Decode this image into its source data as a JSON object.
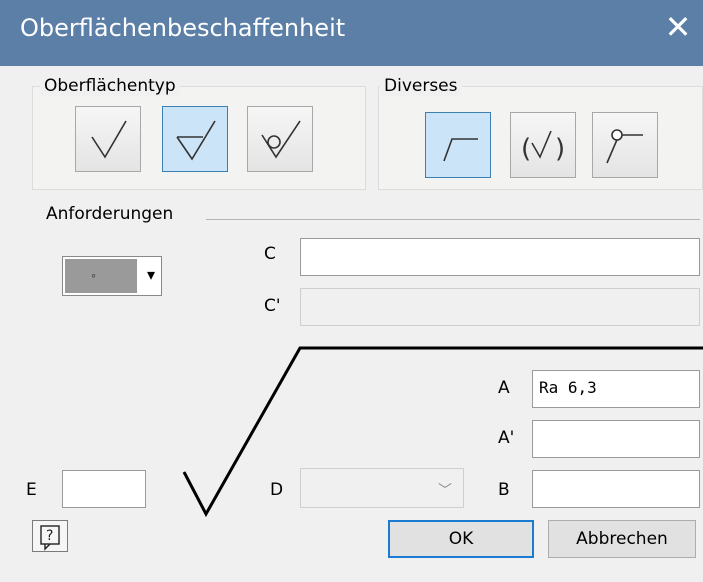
{
  "window": {
    "title": "Oberflächenbeschaffenheit"
  },
  "surface_type": {
    "label": "Oberflächentyp",
    "buttons": [
      {
        "icon": "basic-surface-icon",
        "selected": false
      },
      {
        "icon": "material-removal-required-icon",
        "selected": true
      },
      {
        "icon": "material-removal-prohibited-icon",
        "selected": false
      }
    ]
  },
  "misc": {
    "label": "Diverses",
    "buttons": [
      {
        "icon": "long-leg-icon",
        "selected": true
      },
      {
        "icon": "parentheses-symbol-icon",
        "selected": false
      },
      {
        "icon": "all-around-icon",
        "selected": false
      }
    ]
  },
  "requirements": {
    "label": "Anforderungen",
    "combo_value": "◦",
    "C_label": "C",
    "C_value": "",
    "C_prime_label": "C'",
    "C_prime_value": "",
    "A_label": "A",
    "A_value": "Ra 6,3",
    "A_prime_label": "A'",
    "A_prime_value": "",
    "B_label": "B",
    "B_value": "",
    "D_label": "D",
    "D_value": "",
    "E_label": "E",
    "E_value": ""
  },
  "buttons": {
    "ok": "OK",
    "cancel": "Abbrechen"
  }
}
